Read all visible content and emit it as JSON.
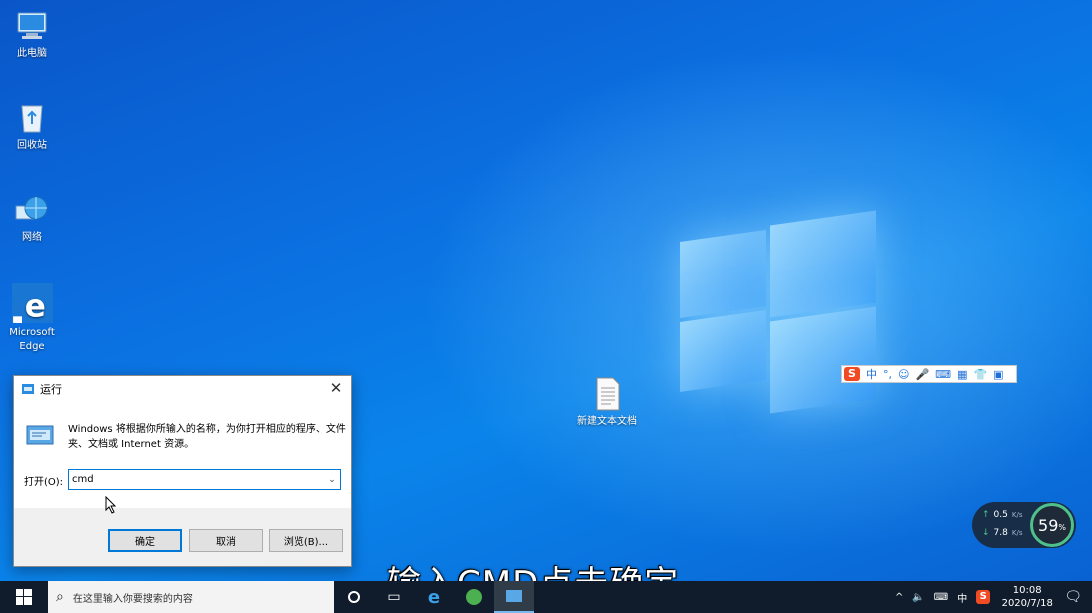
{
  "desktop": {
    "icons": [
      {
        "label": "此电脑"
      },
      {
        "label": "回收站"
      },
      {
        "label": "网络"
      },
      {
        "label": "Microsoft Edge"
      },
      {
        "label": "新建文本文档"
      }
    ]
  },
  "run_dialog": {
    "title": "运行",
    "close_glyph": "✕",
    "description": "Windows 将根据你所输入的名称，为你打开相应的程序、文件夹、文档或 Internet 资源。",
    "open_label": "打开(O):",
    "open_value": "cmd",
    "ok_label": "确定",
    "cancel_label": "取消",
    "browse_label": "浏览(B)..."
  },
  "ime_bar": {
    "logo": "S",
    "mode": "中",
    "punct": "°,"
  },
  "net_widget": {
    "up_speed": "0.5",
    "up_unit": "K/s",
    "down_speed": "7.8",
    "down_unit": "K/s",
    "percent": "59",
    "percent_sign": "%"
  },
  "caption": "输入CMD点击确定",
  "taskbar": {
    "search_placeholder": "在这里输入你要搜索的内容",
    "ime_indicator": "中",
    "time": "10:08",
    "date": "2020/7/18"
  },
  "colors": {
    "accent": "#0078d7",
    "taskbar": "#101c2c",
    "sogou": "#f04b23"
  }
}
